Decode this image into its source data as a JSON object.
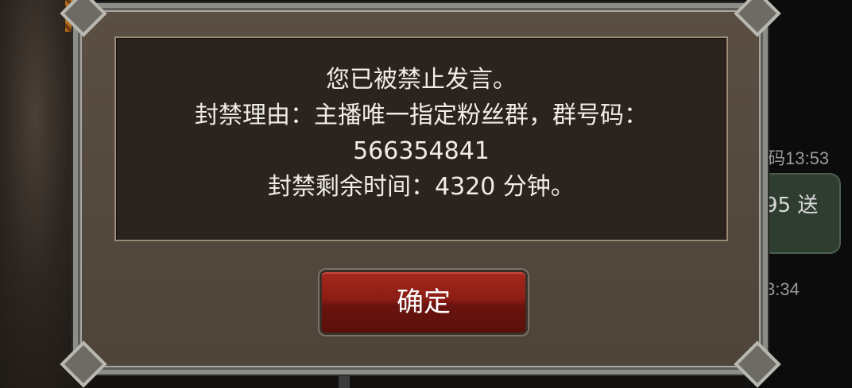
{
  "dialog": {
    "message_line1": "您已被禁止发言。",
    "message_line2": "封禁理由：主播唯一指定粉丝群，群号码：",
    "message_line3": "566354841",
    "message_line4": "封禁剩余时间：4320 分钟。",
    "confirm_label": "确定"
  },
  "background_chat": {
    "time1": "码13:53",
    "bubble_text": "95 送",
    "time2": "3:34"
  },
  "colors": {
    "dialog_frame": "#8d8d88",
    "message_panel": "#2b231e",
    "confirm_button": "#8c1d15"
  }
}
